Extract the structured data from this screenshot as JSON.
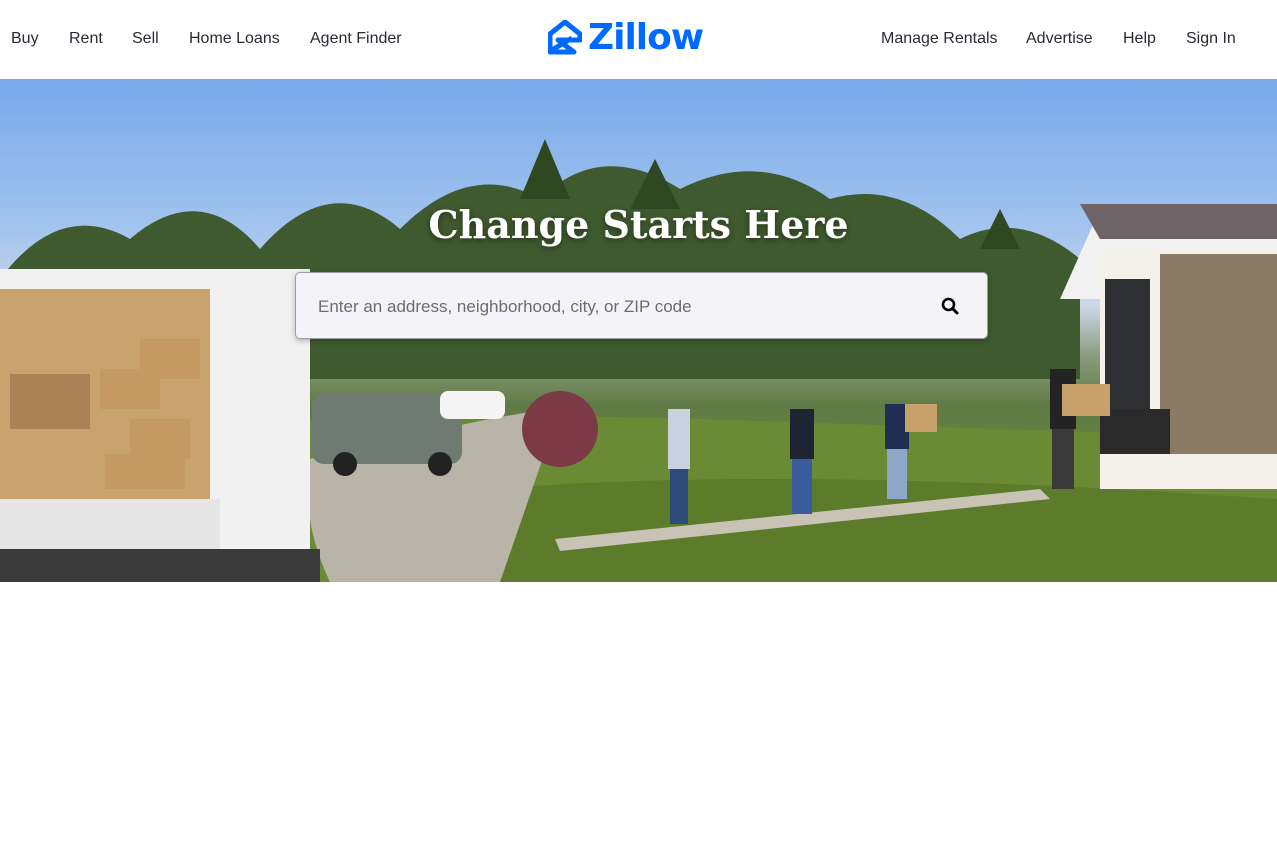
{
  "nav": {
    "left": [
      {
        "label": "Buy"
      },
      {
        "label": "Rent"
      },
      {
        "label": "Sell"
      },
      {
        "label": "Home Loans"
      },
      {
        "label": "Agent Finder"
      }
    ],
    "right": [
      {
        "label": "Manage Rentals"
      },
      {
        "label": "Advertise"
      },
      {
        "label": "Help"
      },
      {
        "label": "Sign In"
      }
    ]
  },
  "logo": {
    "text": "Zillow",
    "icon": "zillow-house-icon",
    "color": "#006aff"
  },
  "hero": {
    "title": "Change Starts Here",
    "search": {
      "placeholder": "Enter an address, neighborhood, city, or ZIP code",
      "value": "",
      "icon": "search-icon"
    }
  }
}
